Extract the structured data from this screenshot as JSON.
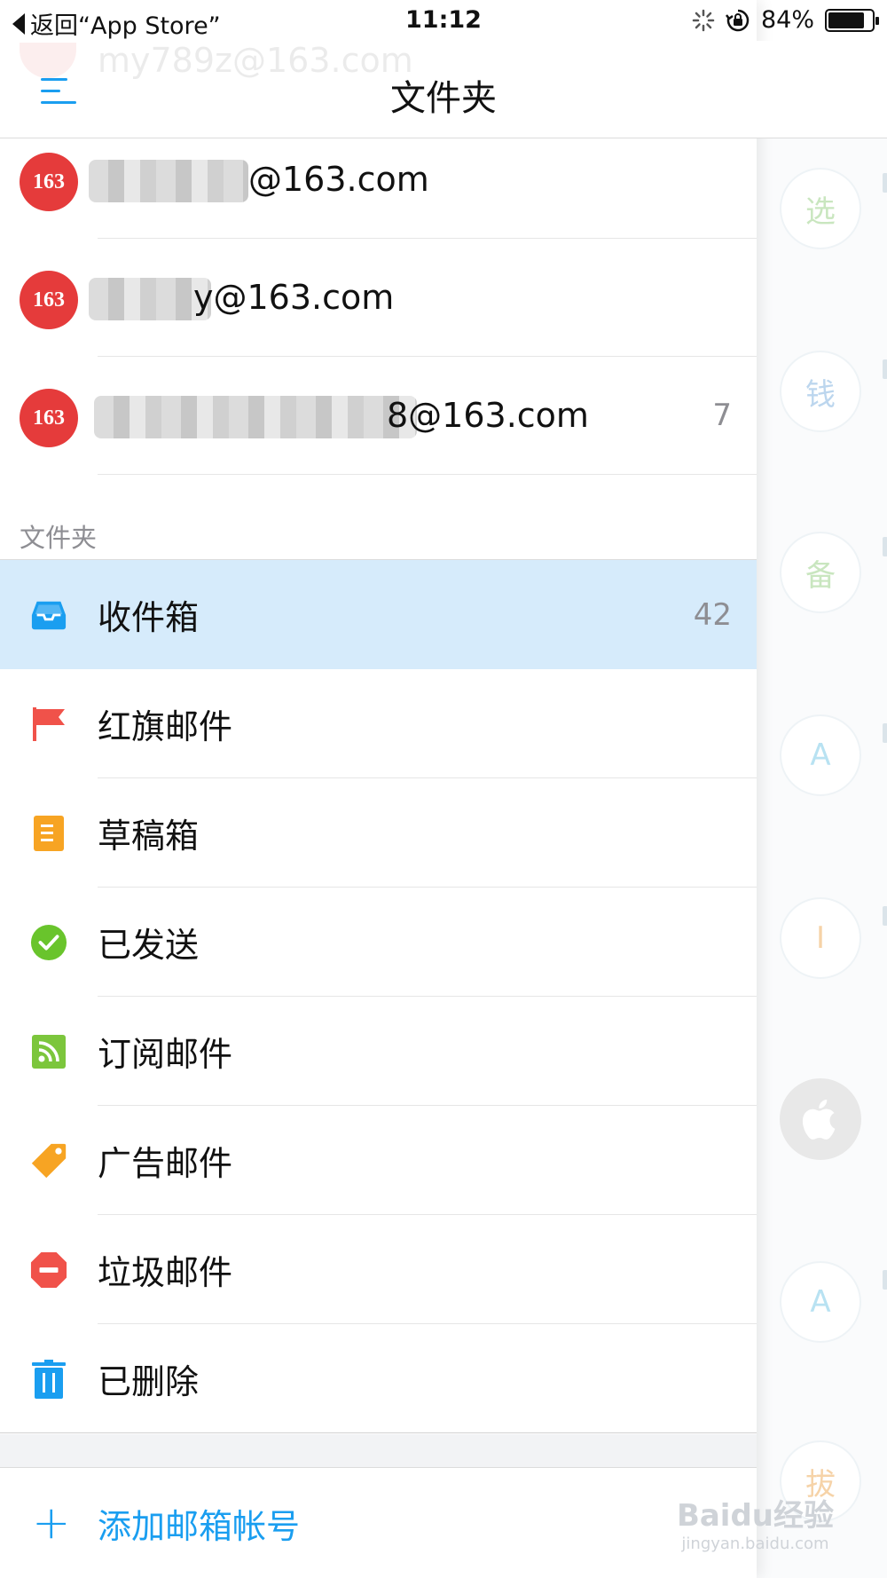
{
  "status_bar": {
    "back_text": "返回“App Store”",
    "time": "11:12",
    "battery": "84%"
  },
  "navbar": {
    "ghost_account": "my789z@163.com",
    "title": "文件夹"
  },
  "accounts": [
    {
      "badge": "163",
      "email": "@163.com",
      "count": ""
    },
    {
      "badge": "163",
      "email": "y@163.com",
      "count": ""
    },
    {
      "badge": "163",
      "email": "8@163.com",
      "count": "7"
    }
  ],
  "section_label": "文件夹",
  "folders": [
    {
      "label": "收件箱",
      "count": "42",
      "icon": "inbox-icon",
      "color": "#1a9ef0"
    },
    {
      "label": "红旗邮件",
      "count": "",
      "icon": "flag-icon",
      "color": "#f0524a"
    },
    {
      "label": "草稿箱",
      "count": "",
      "icon": "draft-icon",
      "color": "#f7a423"
    },
    {
      "label": "已发送",
      "count": "",
      "icon": "check-circle-icon",
      "color": "#69c42c"
    },
    {
      "label": "订阅邮件",
      "count": "",
      "icon": "rss-icon",
      "color": "#7cc63c"
    },
    {
      "label": "广告邮件",
      "count": "",
      "icon": "tag-icon",
      "color": "#f7a423"
    },
    {
      "label": "垃圾邮件",
      "count": "",
      "icon": "block-icon",
      "color": "#f0524a"
    },
    {
      "label": "已删除",
      "count": "",
      "icon": "trash-icon",
      "color": "#1a9ef0"
    }
  ],
  "add_account": {
    "label": "添加邮箱帐号"
  },
  "background_list": {
    "avatars": [
      "选",
      "钱",
      "备",
      "A",
      "I",
      "",
      "A",
      "拔"
    ]
  },
  "watermark": {
    "line1": "Baidu经验",
    "line2": "jingyan.baidu.com"
  },
  "colors": {
    "accent": "#1a9ef0",
    "selected_bg": "#d6ebfb",
    "badge_red": "#e53b3b"
  }
}
